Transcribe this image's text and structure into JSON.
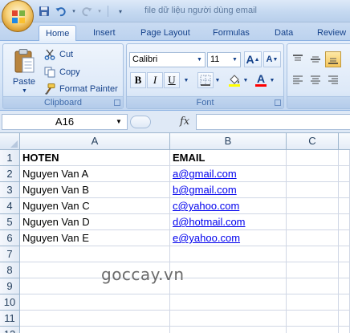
{
  "window": {
    "title": "file dữ liệu người dùng email"
  },
  "tabs": [
    {
      "label": "Home",
      "active": true
    },
    {
      "label": "Insert"
    },
    {
      "label": "Page Layout"
    },
    {
      "label": "Formulas"
    },
    {
      "label": "Data"
    },
    {
      "label": "Review"
    }
  ],
  "clipboard": {
    "paste_label": "Paste",
    "cut_label": "Cut",
    "copy_label": "Copy",
    "format_painter_label": "Format Painter",
    "group_label": "Clipboard"
  },
  "font": {
    "name": "Calibri",
    "size": "11",
    "group_label": "Font",
    "bold_label": "B",
    "italic_label": "I",
    "underline_label": "U",
    "font_color_label": "A",
    "grow_label": "A",
    "shrink_label": "A"
  },
  "formula_bar": {
    "name_box": "A16",
    "fx_label": "fx",
    "value": ""
  },
  "sheet": {
    "columns": [
      "A",
      "B",
      "C"
    ],
    "rows": [
      "1",
      "2",
      "3",
      "4",
      "5",
      "6",
      "7",
      "8",
      "9",
      "10",
      "11",
      "12"
    ],
    "headers": {
      "a": "HOTEN",
      "b": "EMAIL"
    },
    "records": [
      {
        "name": "Nguyen Van A",
        "email": "a@gmail.com"
      },
      {
        "name": "Nguyen Van B",
        "email": "b@gmail.com"
      },
      {
        "name": "Nguyen Van C",
        "email": "c@yahoo.com"
      },
      {
        "name": "Nguyen Van D",
        "email": "d@hotmail.com"
      },
      {
        "name": "Nguyen Van E",
        "email": "e@yahoo.com"
      }
    ]
  },
  "watermark": "goccay.vn",
  "colors": {
    "ribbon_text": "#15428b",
    "hyperlink": "#0000ee",
    "header_selected": "#f1c15f"
  }
}
